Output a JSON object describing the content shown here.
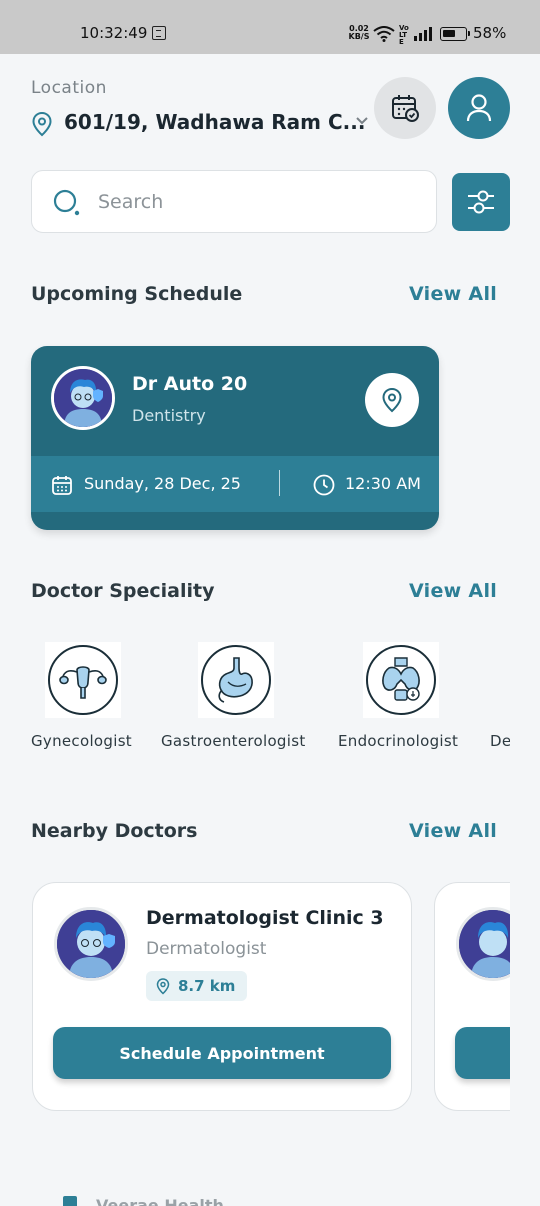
{
  "status_bar": {
    "time": "10:32:49",
    "speed_value": "0.02",
    "speed_unit": "KB/S",
    "volte": "Vo LTE",
    "battery": "58%"
  },
  "header": {
    "location_label": "Location",
    "location_value": "601/19, Wadhawa Ram C...",
    "calendar_icon": "calendar-check-icon",
    "profile_icon": "user-icon"
  },
  "search": {
    "placeholder": "Search",
    "value": "",
    "filter_icon": "sliders-icon"
  },
  "upcoming": {
    "title": "Upcoming Schedule",
    "view_all": "View All",
    "card": {
      "doctor_name": "Dr Auto 20",
      "speciality": "Dentistry",
      "date": "Sunday, 28 Dec, 25",
      "time": "12:30 AM"
    }
  },
  "speciality": {
    "title": "Doctor Speciality",
    "view_all": "View All",
    "items": [
      {
        "label": "Gynecologist",
        "icon": "uterus-icon"
      },
      {
        "label": "Gastroenterologist",
        "icon": "stomach-icon"
      },
      {
        "label": "Endocrinologist",
        "icon": "thyroid-icon"
      },
      {
        "label": "De",
        "icon": ""
      }
    ]
  },
  "nearby": {
    "title": "Nearby Doctors",
    "view_all": "View All",
    "cards": [
      {
        "name": "Dermatologist Clinic 3",
        "speciality": "Dermatologist",
        "distance": "8.7 km",
        "button": "Schedule Appointment"
      },
      {
        "name": "",
        "speciality": "",
        "distance": "",
        "button": ""
      }
    ]
  },
  "footer": {
    "text": "Veerae Health"
  },
  "colors": {
    "primary": "#2d7f96",
    "primary_dark": "#246a7d",
    "background": "#f4f6f8"
  }
}
